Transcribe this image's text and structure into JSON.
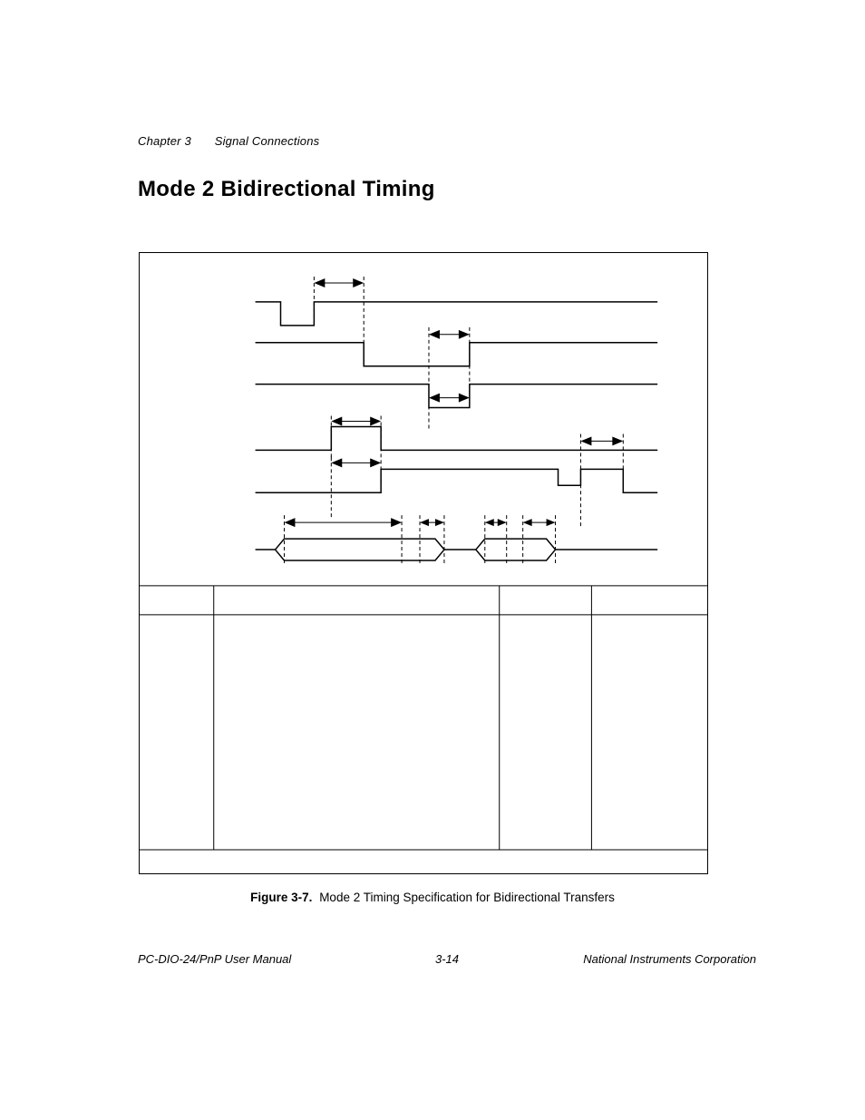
{
  "header": {
    "chapter": "Chapter 3",
    "section_group": "Signal Connections"
  },
  "title": "Mode 2 Bidirectional Timing",
  "figure": {
    "number": "Figure 3-7.",
    "caption": "Mode 2 Timing Specification for Bidirectional Transfers"
  },
  "footer": {
    "left": "PC-DIO-24/PnP User Manual",
    "center": "3-14",
    "right": "National Instruments Corporation"
  }
}
